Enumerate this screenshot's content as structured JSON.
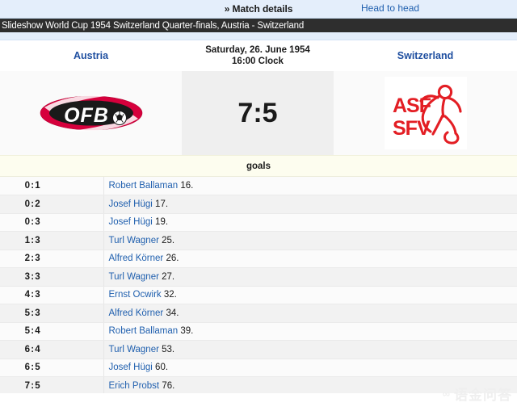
{
  "topbar": {
    "match_details_label": "» Match details",
    "head_to_head_label": "Head to head"
  },
  "slideshow": {
    "title": "Slideshow World Cup 1954 Switzerland Quarter-finals, Austria - Switzerland"
  },
  "match": {
    "home_team": "Austria",
    "away_team": "Switzerland",
    "date_line1": "Saturday, 26. June 1954",
    "date_line2": "16:00 Clock",
    "score": "7:5",
    "home_logo_text": "OFB",
    "away_logo_line1": "ASF",
    "away_logo_line2": "SFV"
  },
  "goals": {
    "header": "goals",
    "rows": [
      {
        "score": "0:1",
        "scorer": "Robert Ballaman",
        "minute": "16.",
        "side": "away"
      },
      {
        "score": "0:2",
        "scorer": "Josef Hügi",
        "minute": "17.",
        "side": "away"
      },
      {
        "score": "0:3",
        "scorer": "Josef Hügi",
        "minute": "19.",
        "side": "away"
      },
      {
        "score": "1:3",
        "scorer": "Turl Wagner",
        "minute": "25.",
        "side": "home"
      },
      {
        "score": "2:3",
        "scorer": "Alfred Körner",
        "minute": "26.",
        "side": "home"
      },
      {
        "score": "3:3",
        "scorer": "Turl Wagner",
        "minute": "27.",
        "side": "home"
      },
      {
        "score": "4:3",
        "scorer": "Ernst Ocwirk",
        "minute": "32.",
        "side": "home"
      },
      {
        "score": "5:3",
        "scorer": "Alfred Körner",
        "minute": "34.",
        "side": "home"
      },
      {
        "score": "5:4",
        "scorer": "Robert Ballaman",
        "minute": "39.",
        "side": "away"
      },
      {
        "score": "6:4",
        "scorer": "Turl Wagner",
        "minute": "53.",
        "side": "home"
      },
      {
        "score": "6:5",
        "scorer": "Josef Hügi",
        "minute": "60.",
        "side": "away"
      },
      {
        "score": "7:5",
        "scorer": "Erich Probst",
        "minute": "76.",
        "side": "home"
      }
    ]
  },
  "watermark": {
    "text": "语金问答",
    "mark": "∞"
  },
  "colors": {
    "header_blue_bg": "#e4eefb",
    "link_blue": "#1f5fae",
    "team_blue": "#1f4fa0",
    "dark_bar": "#2e2e2e",
    "goals_band": "#fdfdef",
    "row_odd": "#fbfbfb",
    "row_even": "#f2f2f2",
    "score_box": "#efefef",
    "ofb_red": "#d6003c",
    "sfv_red": "#e31e24"
  }
}
